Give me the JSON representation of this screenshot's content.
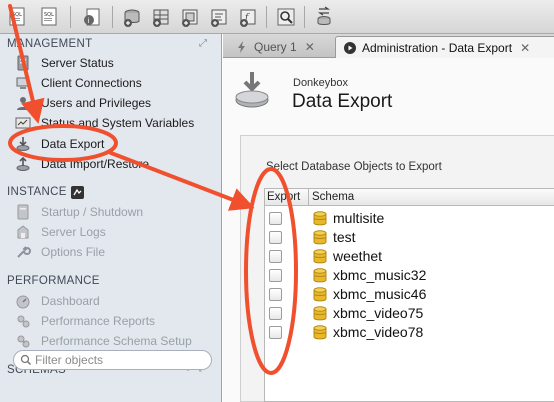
{
  "sidebar": {
    "management": {
      "heading": "MANAGEMENT",
      "items": [
        {
          "label": "Server Status",
          "icon": "server-status-icon"
        },
        {
          "label": "Client Connections",
          "icon": "client-connections-icon"
        },
        {
          "label": "Users and Privileges",
          "icon": "users-icon"
        },
        {
          "label": "Status and System Variables",
          "icon": "variables-icon"
        },
        {
          "label": "Data Export",
          "icon": "data-export-icon"
        },
        {
          "label": "Data Import/Restore",
          "icon": "data-import-icon"
        }
      ]
    },
    "instance": {
      "heading": "INSTANCE",
      "items": [
        {
          "label": "Startup / Shutdown",
          "icon": "startup-icon"
        },
        {
          "label": "Server Logs",
          "icon": "server-logs-icon"
        },
        {
          "label": "Options File",
          "icon": "wrench-icon"
        }
      ]
    },
    "performance": {
      "heading": "PERFORMANCE",
      "items": [
        {
          "label": "Dashboard",
          "icon": "dashboard-icon"
        },
        {
          "label": "Performance Reports",
          "icon": "reports-icon"
        },
        {
          "label": "Performance Schema Setup",
          "icon": "schema-setup-icon"
        }
      ]
    },
    "schemas": {
      "heading": "SCHEMAS",
      "filter_placeholder": "Filter objects"
    }
  },
  "tabs": [
    {
      "label": "Query 1",
      "close": "✕"
    },
    {
      "label": "Administration - Data Export",
      "close": "✕"
    }
  ],
  "content": {
    "subtitle": "Donkeybox",
    "title": "Data Export",
    "select_label": "Select Database Objects to Export",
    "columns": {
      "export": "Export",
      "schema": "Schema"
    },
    "schemas": [
      "multisite",
      "test",
      "weethet",
      "xbmc_music32",
      "xbmc_music46",
      "xbmc_video75",
      "xbmc_video78"
    ]
  },
  "colors": {
    "annotation": "#f0502e",
    "sidebar_bg": "#e3e7ee",
    "db_icon": "#e8b72a"
  }
}
